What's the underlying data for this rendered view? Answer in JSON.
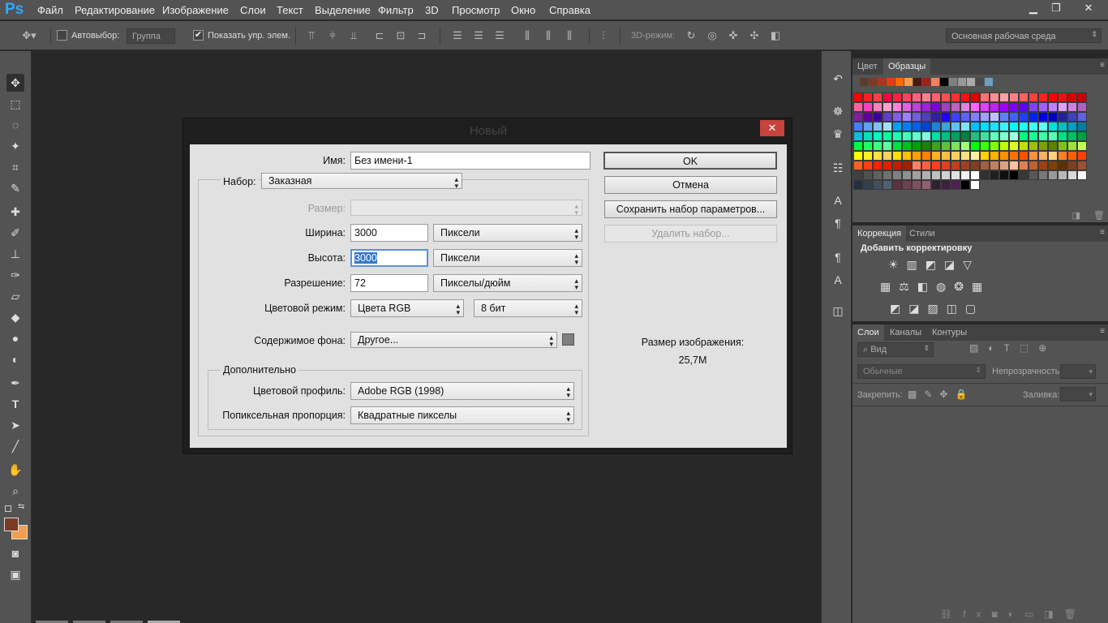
{
  "app": {
    "logo": "Ps",
    "window_controls": {
      "minimize": "▁",
      "restore": "❐",
      "close": "✕"
    }
  },
  "menu": [
    "Файл",
    "Редактирование",
    "Изображение",
    "Слои",
    "Текст",
    "Выделение",
    "Фильтр",
    "3D",
    "Просмотр",
    "Окно",
    "Справка"
  ],
  "options_bar": {
    "autoselect_label": "Автовыбор:",
    "group_select": "Группа",
    "show_controls_label": "Показать упр. элем.",
    "mode_3d_label": "3D-режим:",
    "workspace": "Основная рабочая среда"
  },
  "right_panel": {
    "swatches_tabs": [
      "Цвет",
      "Образцы"
    ],
    "adjust_tabs": [
      "Коррекция",
      "Стили"
    ],
    "adjust_title": "Добавить корректировку",
    "layers_tabs": [
      "Слои",
      "Каналы",
      "Контуры"
    ],
    "layers_filter": "Вид",
    "blend_mode": "Обычные",
    "opacity_label": "Непрозрачность:",
    "lock_label": "Закрепить:",
    "fill_label": "Заливка:"
  },
  "dialog": {
    "title": "Новый",
    "close": "✕",
    "name_label": "Имя:",
    "name_value": "Без имени-1",
    "preset_label": "Набор:",
    "preset_value": "Заказная",
    "size_label": "Размер:",
    "width_label": "Ширина:",
    "width_value": "3000",
    "width_unit": "Пиксели",
    "height_label": "Высота:",
    "height_value": "3000",
    "height_unit": "Пиксели",
    "resolution_label": "Разрешение:",
    "resolution_value": "72",
    "resolution_unit": "Пикселы/дюйм",
    "color_mode_label": "Цветовой режим:",
    "color_mode_value": "Цвета RGB",
    "bit_depth": "8 бит",
    "background_label": "Содержимое фона:",
    "background_value": "Другое...",
    "background_color": "#7f7f7f",
    "advanced_label": "Дополнительно",
    "profile_label": "Цветовой профиль:",
    "profile_value": "Adobe RGB (1998)",
    "pixel_aspect_label": "Попиксельная пропорция:",
    "pixel_aspect_value": "Квадратные пикселы",
    "ok": "OK",
    "cancel": "Отмена",
    "save_preset": "Сохранить набор параметров...",
    "delete_preset": "Удалить набор...",
    "image_size_label": "Размер изображения:",
    "image_size_value": "25,7M"
  },
  "colors": {
    "foreground": "#7a3a24",
    "background": "#f0a050",
    "accent": "#31a8ff"
  }
}
